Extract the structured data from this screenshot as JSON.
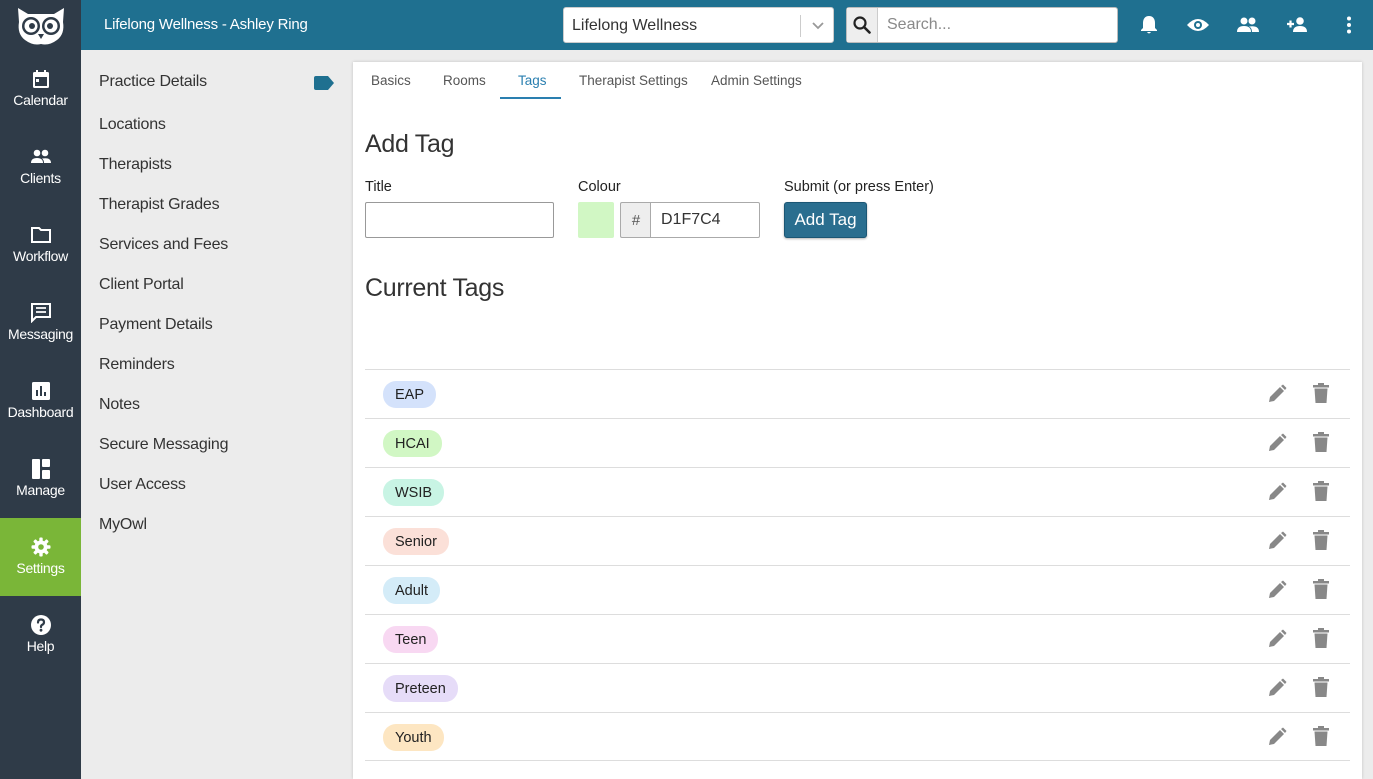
{
  "header": {
    "app_title": "Lifelong Wellness - Ashley Ring",
    "practice_select": "Lifelong Wellness",
    "search_placeholder": "Search..."
  },
  "nav": [
    {
      "label": "Calendar",
      "icon": "calendar-icon"
    },
    {
      "label": "Clients",
      "icon": "clients-icon"
    },
    {
      "label": "Workflow",
      "icon": "folder-icon"
    },
    {
      "label": "Messaging",
      "icon": "message-icon"
    },
    {
      "label": "Dashboard",
      "icon": "chart-icon"
    },
    {
      "label": "Manage",
      "icon": "manage-icon"
    },
    {
      "label": "Settings",
      "icon": "gear-icon"
    },
    {
      "label": "Help",
      "icon": "help-icon"
    }
  ],
  "settings_menu": [
    "Practice Details",
    "Locations",
    "Therapists",
    "Therapist Grades",
    "Services and Fees",
    "Client Portal",
    "Payment Details",
    "Reminders",
    "Notes",
    "Secure Messaging",
    "User Access",
    "MyOwl"
  ],
  "tabs": [
    "Basics",
    "Rooms",
    "Tags",
    "Therapist Settings",
    "Admin Settings"
  ],
  "add_tag": {
    "heading": "Add Tag",
    "title_label": "Title",
    "title_value": "",
    "colour_label": "Colour",
    "hash": "#",
    "colour_value": "D1F7C4",
    "submit_label": "Submit (or press Enter)",
    "button": "Add Tag"
  },
  "current_tags": {
    "heading": "Current Tags",
    "tags": [
      {
        "name": "EAP",
        "color": "#d4e2fb"
      },
      {
        "name": "HCAI",
        "color": "#d1f7c4"
      },
      {
        "name": "WSIB",
        "color": "#c8f4e4"
      },
      {
        "name": "Senior",
        "color": "#fbe0d8"
      },
      {
        "name": "Adult",
        "color": "#d4ecf8"
      },
      {
        "name": "Teen",
        "color": "#f8d8f2"
      },
      {
        "name": "Preteen",
        "color": "#e6dcf8"
      },
      {
        "name": "Youth",
        "color": "#fde6c2"
      }
    ]
  },
  "colors": {
    "topbar": "#1f7090",
    "sidebar": "#2f3b48",
    "active_nav": "#7ab638",
    "tag_badge": "#1f7090",
    "button": "#2a6e8f",
    "active_tab": "#2a7fb0"
  }
}
